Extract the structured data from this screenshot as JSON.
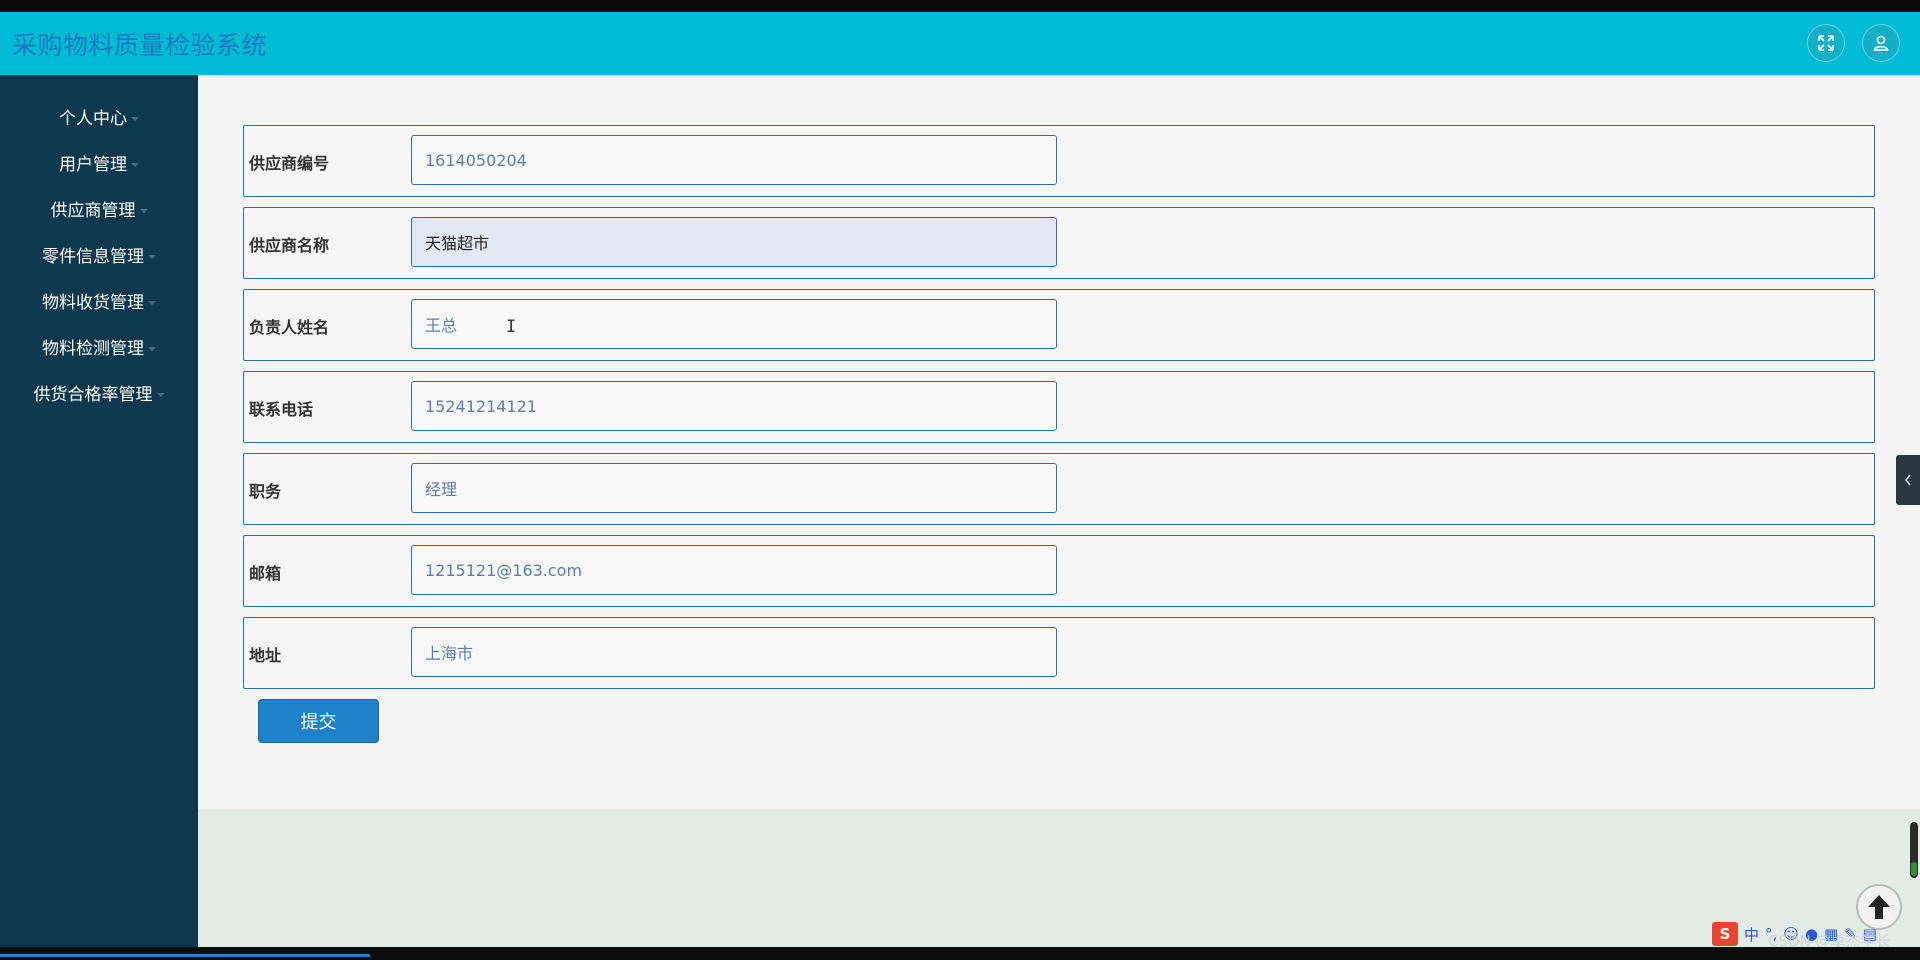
{
  "header": {
    "title": "采购物料质量检验系统",
    "fullscreen_icon": "fullscreen-icon",
    "user_icon": "user-icon",
    "background_color": "#00bcd4"
  },
  "sidebar": {
    "background_color": "#0d384e",
    "items": [
      {
        "label": "个人中心"
      },
      {
        "label": "用户管理"
      },
      {
        "label": "供应商管理"
      },
      {
        "label": "零件信息管理"
      },
      {
        "label": "物料收货管理"
      },
      {
        "label": "物料检测管理"
      },
      {
        "label": "供货合格率管理"
      }
    ]
  },
  "form": {
    "fields": [
      {
        "label": "供应商编号",
        "value": "1614050204"
      },
      {
        "label": "供应商名称",
        "value": "天猫超市"
      },
      {
        "label": "负责人姓名",
        "value": "王总"
      },
      {
        "label": "联系电话",
        "value": "15241214121"
      },
      {
        "label": "职务",
        "value": "经理"
      },
      {
        "label": "邮箱",
        "value": "1215121@163.com"
      },
      {
        "label": "地址",
        "value": "上海市"
      }
    ],
    "submit_label": "提交"
  },
  "overlay": {
    "side_tab_icon": "chevron-left-icon",
    "back_to_top_icon": "arrow-up-icon",
    "ime_text": "中",
    "watermark": "CSDN @卓杰学长"
  }
}
